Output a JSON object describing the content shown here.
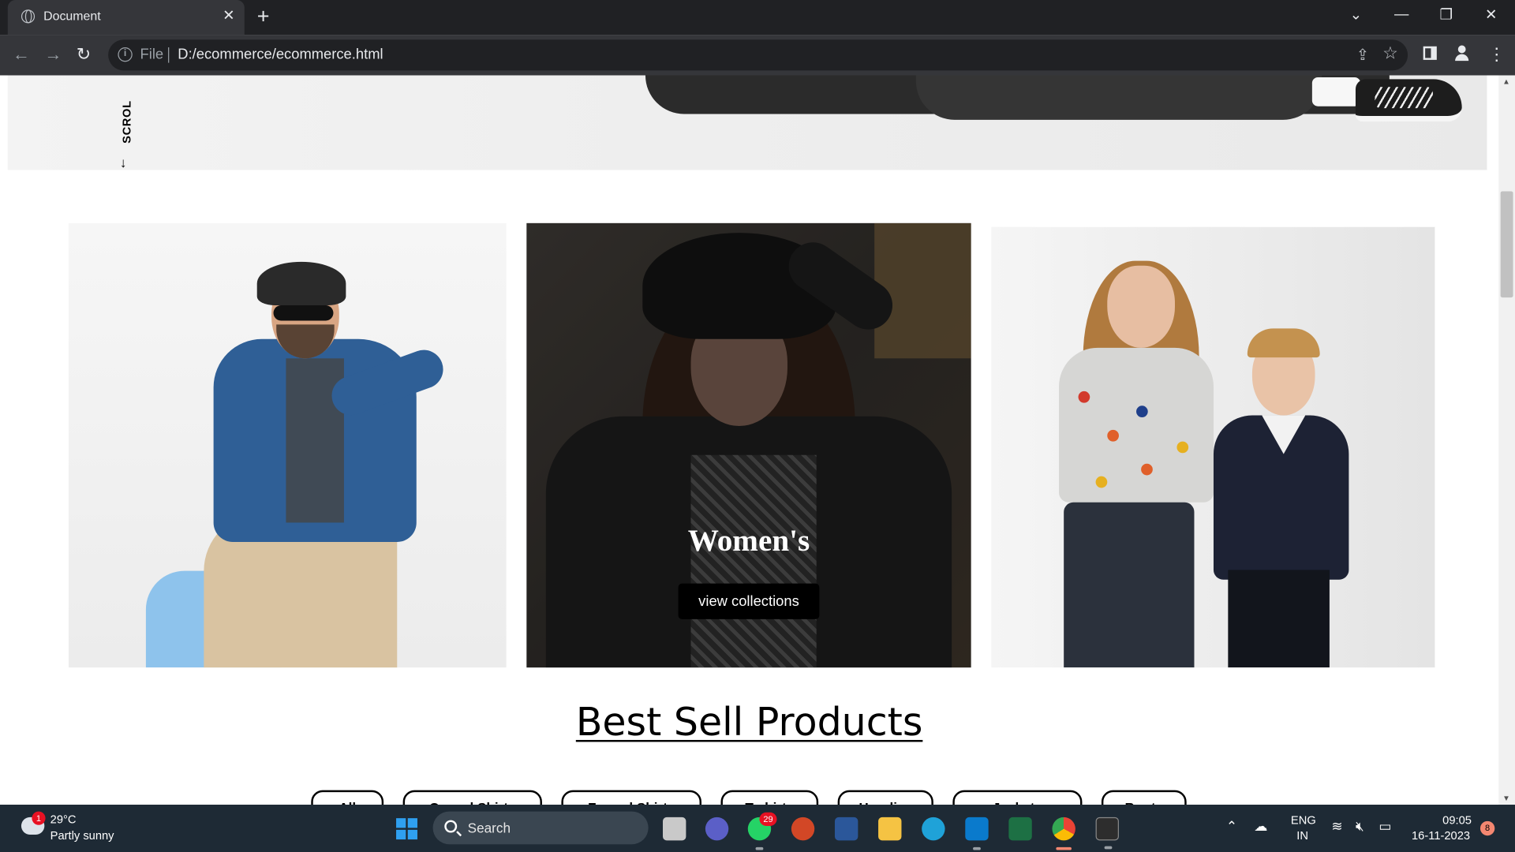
{
  "browser": {
    "tab_title": "Document",
    "tab_close": "✕",
    "new_tab": "+",
    "scheme": "File",
    "url": "D:/ecommerce/ecommerce.html",
    "win_dropdown": "⌄",
    "win_minimize": "—",
    "win_restore": "❐",
    "win_close": "✕"
  },
  "page": {
    "scroll_label": "SCROL",
    "scroll_arrow": "↓",
    "cards": {
      "women_title": "Women's",
      "women_button": "view collections"
    },
    "section_title": "Best Sell Products",
    "filters": [
      "All",
      "Casual Shirts",
      "Formal Shirts",
      "T-shirts",
      "Hoodies",
      "Jackets",
      "Boots"
    ]
  },
  "taskbar": {
    "weather_badge": "1",
    "weather_temp": "29°C",
    "weather_desc": "Partly sunny",
    "search_label": "Search",
    "whatsapp_badge": "29",
    "lang_line1": "ENG",
    "lang_line2": "IN",
    "time": "09:05",
    "date": "16-11-2023",
    "notifications": "8"
  },
  "icons": {
    "back": "back-arrow-icon",
    "forward": "forward-arrow-icon",
    "reload": "reload-icon",
    "info": "info-icon",
    "share": "share-icon",
    "star": "bookmark-star-icon",
    "side_panel": "side-panel-icon",
    "profile": "profile-icon",
    "menu": "kebab-menu-icon"
  },
  "colors": {
    "browser_dark": "#202124",
    "toolbar": "#35363a",
    "taskbar": "#1e2a35",
    "button_black": "#000000"
  }
}
